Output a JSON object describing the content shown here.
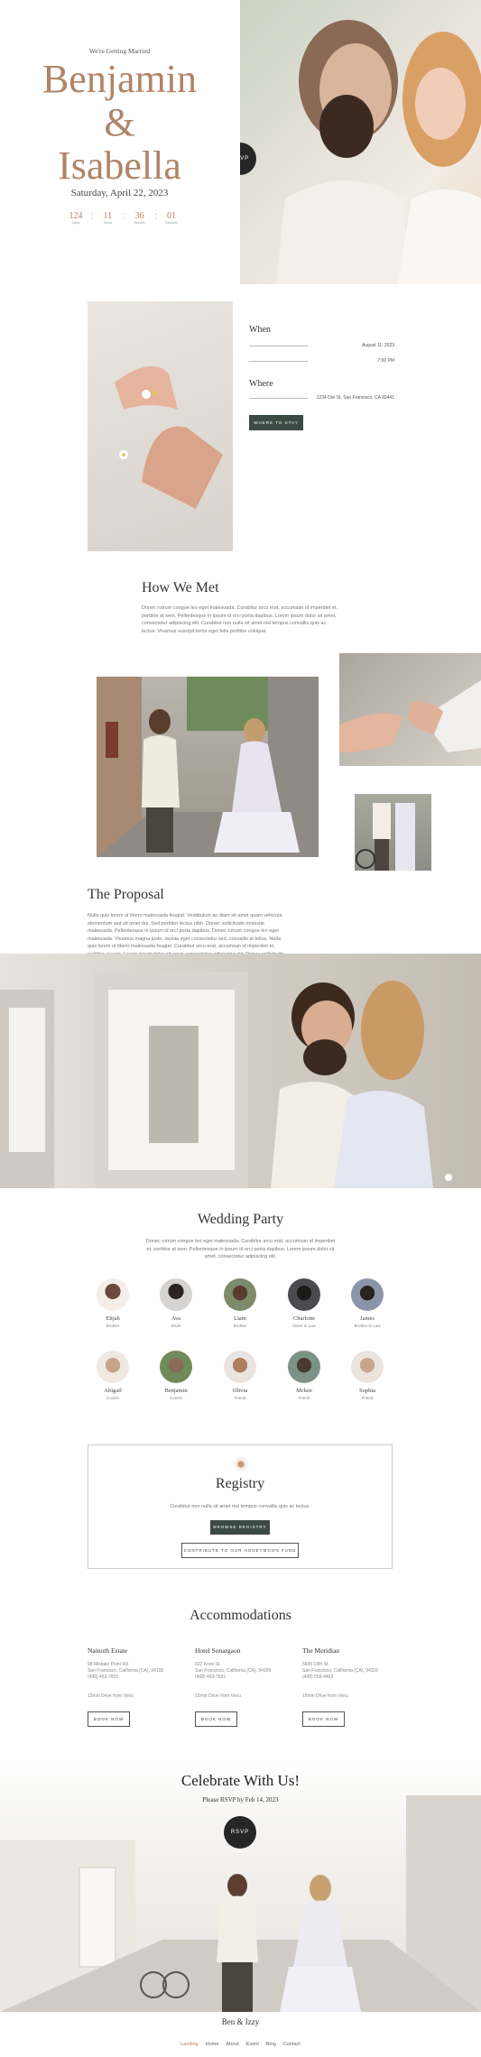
{
  "hero": {
    "kicker": "We're Getting Married",
    "name1": "Benjamin",
    "amp": "&",
    "name2": "Isabella",
    "date": "Saturday, April 22, 2023",
    "countdown": [
      {
        "value": "124",
        "unit": "Days"
      },
      {
        "value": "11",
        "unit": "Hours"
      },
      {
        "value": "36",
        "unit": "Minutes"
      },
      {
        "value": "01",
        "unit": "Seconds"
      }
    ],
    "rsvp_label": "RSVP"
  },
  "details": {
    "when_label": "When",
    "date_value": "August 11, 2023",
    "time_value": "7:00 PM",
    "where_label": "Where",
    "address_value": "1234 Divi St. San Francisco, CA 92441",
    "directions_label": "WHERE TO STAY"
  },
  "story": {
    "title": "How We Met",
    "body": "Donec rutrum congue leo eget malesuada. Curabitur arcu erat, accumsan id imperdiet et, porttitor at sem. Pellentesque in ipsum id orci porta dapibus. Lorem ipsum dolor sit amet, consectetur adipiscing elit. Curabitur non nulla sit amet nisl tempus convallis quis ac lectus. Vivamus suscipit tortor eget felis porttitor volutpat."
  },
  "proposal": {
    "title": "The Proposal",
    "body": "Nulla quis lorem ut libero malesuada feugiat. Vestibulum ac diam sit amet quam vehicula elementum sed sit amet dui. Sed porttitor lectus nibh. Donec sollicitudin molestie malesuada. Pellentesque in ipsum id orci porta dapibus. Donec rutrum congue leo eget malesuada. Vivamus magna justo, lacinia eget consectetur sed, convallis at tellus. Nulla quis lorem ut libero malesuada feugiat. Curabitur arcu erat, accumsan id imperdiet et, porttitor at sem. Lorem ipsum dolor sit amet, consectetur adipiscing elit. Donec sollicitudin molestie malesuada. Donec velit neque, auctor sit amet aliquam vel, ullamcorper sit amet ligula."
  },
  "party": {
    "title": "Wedding Party",
    "intro": "Donec rutrum congue leo eget malesuada. Curabitur arcu erat, accumsan id imperdiet et, porttitor at sem. Pellentesque in ipsum id orci porta dapibus. Lorem ipsum dolor sit amet, consectetur adipiscing elit.",
    "members": [
      {
        "name": "Elijah",
        "role": "Brother"
      },
      {
        "name": "Ava",
        "role": "Bride"
      },
      {
        "name": "Liam",
        "role": "Brother"
      },
      {
        "name": "Charlotte",
        "role": "Sister in Law"
      },
      {
        "name": "James",
        "role": "Brother in Law"
      },
      {
        "name": "Abigail",
        "role": "Cousin"
      },
      {
        "name": "Benjamin",
        "role": "Cousin"
      },
      {
        "name": "Olivia",
        "role": "Friend"
      },
      {
        "name": "Mckee",
        "role": "Friend"
      },
      {
        "name": "Sophia",
        "role": "Friend"
      }
    ]
  },
  "registry": {
    "title": "Registry",
    "body": "Curabitur non nulla sit amet nisl tempus convallis quis ac lectus.",
    "browse_label": "BROWSE REGISTRY",
    "fund_label": "CONTRIBUTE TO OUR HONEYMOON FUND"
  },
  "accommodations": {
    "title": "Accommodations",
    "hotels": [
      {
        "name": "Nainoth Estate",
        "addr1": "98 Mistake Point Rd",
        "addr2": "San Francisco, California (CA), 94109",
        "phone": "(408) 463-7821",
        "distance": "15min Drive from Venu",
        "button": "BOOK NOW"
      },
      {
        "name": "Hotel Sonargaon",
        "addr1": "602 Knox St.",
        "addr2": "San Francisco, California (CA), 94109",
        "phone": "(408) 463-7821",
        "distance": "15min Drive from Venu",
        "button": "BOOK NOW"
      },
      {
        "name": "The Meridian",
        "addr1": "5645 19th St.",
        "addr2": "San Francisco, California (CA), 94110",
        "phone": "(408) 558-4463",
        "distance": "15min Drive from Venu",
        "button": "BOOK NOW"
      }
    ]
  },
  "celebrate": {
    "title": "Celebrate With Us!",
    "subtitle": "Please RSVP by Feb 14, 2023",
    "rsvp_label": "RSVP"
  },
  "footer": {
    "brand": "Ben & Izzy",
    "nav": [
      "Landing",
      "Home",
      "About",
      "Event",
      "Blog",
      "Contact"
    ],
    "active_color": "#b08468"
  }
}
